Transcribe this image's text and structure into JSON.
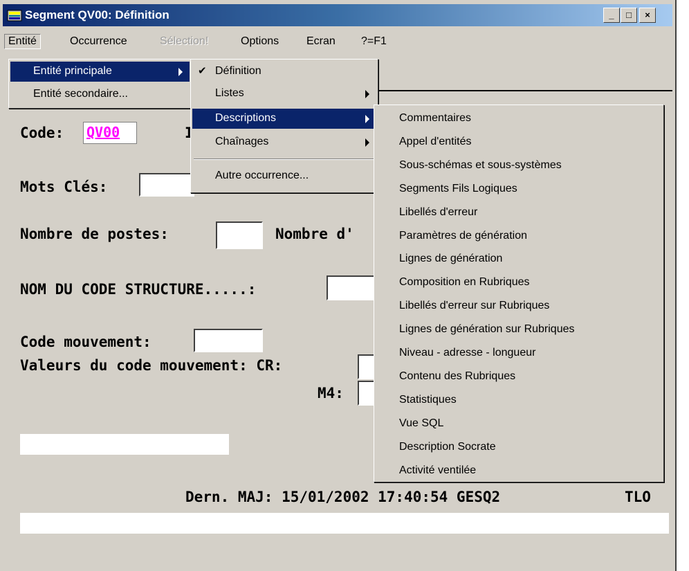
{
  "window": {
    "title": "Segment QV00: Définition",
    "min_label": "_",
    "max_label": "□",
    "close_label": "×"
  },
  "menubar": [
    "Entité",
    "Occurrence",
    "Sélection!",
    "Options",
    "Ecran",
    "?=F1"
  ],
  "entite_menu": [
    "Entité principale",
    "Entité secondaire..."
  ],
  "occurrence_menu": {
    "check_mark": "✔",
    "items": [
      "Définition",
      "Listes",
      "Descriptions",
      "Chaînages"
    ],
    "after_sep": "Autre occurrence..."
  },
  "descriptions_menu": [
    "Commentaires",
    "Appel d'entités",
    "Sous-schémas et sous-systèmes",
    "Segments Fils Logiques",
    "Libellés d'erreur",
    "Paramètres de génération",
    "Lignes de génération",
    "Composition en Rubriques",
    "Libellés d'erreur sur Rubriques",
    "Lignes de génération sur Rubriques",
    "Niveau - adresse - longueur",
    "Contenu des Rubriques",
    "Statistiques",
    "Vue SQL",
    "Description Socrate",
    "Activité ventilée"
  ],
  "form": {
    "code_label": "Code:",
    "code_value": "QV00",
    "code_suffix": "I",
    "mots_cles_label": "Mots Clés:",
    "nombre_postes_label": "Nombre de postes:",
    "nombre_d_label": "Nombre d'",
    "nom_code_structure_label": "NOM DU CODE STRUCTURE.....:",
    "code_mouvement_label": "Code mouvement:",
    "valeurs_label": "Valeurs du code mouvement: CR:",
    "m4_label": "M4:",
    "code_color": "#ff00ff"
  },
  "status": {
    "last_update": "Dern. MAJ: 15/01/2002 17:40:54 GESQ2",
    "user": "TLO"
  }
}
